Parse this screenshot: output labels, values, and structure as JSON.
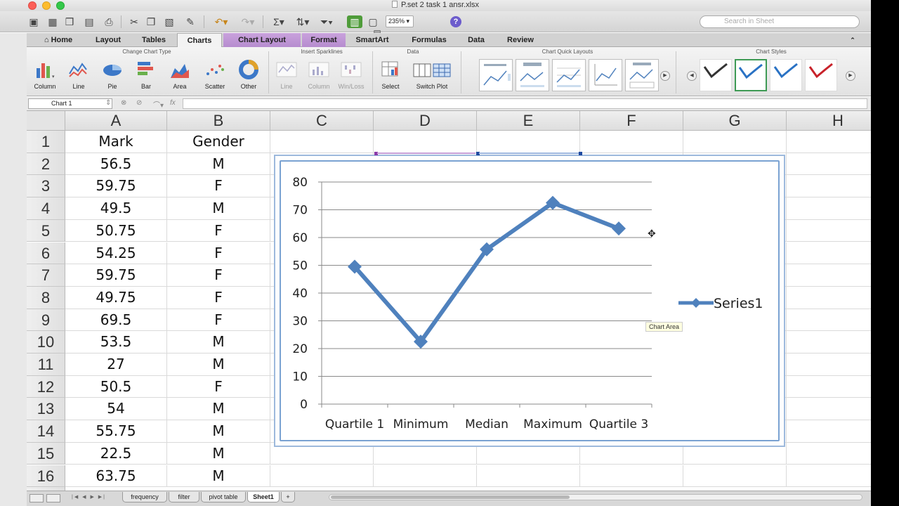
{
  "window": {
    "title": "P.set 2 task 1 ansr.xlsx"
  },
  "toolbar": {
    "zoom": "235%",
    "search_placeholder": "Search in Sheet"
  },
  "tabs": [
    "Home",
    "Layout",
    "Tables",
    "Charts",
    "Chart Layout",
    "Format",
    "SmartArt",
    "Formulas",
    "Data",
    "Review"
  ],
  "ribbon": {
    "groups": {
      "change_chart_type": "Change Chart Type",
      "insert_sparklines": "Insert Sparklines",
      "data": "Data",
      "chart_quick_layouts": "Chart Quick Layouts",
      "chart_styles": "Chart Styles"
    },
    "chart_types": [
      "Column",
      "Line",
      "Pie",
      "Bar",
      "Area",
      "Scatter",
      "Other"
    ],
    "sparklines": [
      "Line",
      "Column",
      "Win/Loss"
    ],
    "data_buttons": [
      "Select",
      "Switch Plot"
    ],
    "style_colors": [
      "#333333",
      "#2a72c4",
      "#2a72c4",
      "#c8222a"
    ]
  },
  "formula_bar": {
    "name_box": "Chart 1",
    "fx": "fx"
  },
  "sheet": {
    "columns": [
      "A",
      "B",
      "C",
      "D",
      "E",
      "F",
      "G",
      "H"
    ],
    "rows": [
      "1",
      "2",
      "3",
      "4",
      "5",
      "6",
      "7",
      "8",
      "9",
      "10",
      "11",
      "12",
      "13",
      "14",
      "15",
      "16"
    ],
    "headers": [
      "Mark",
      "Gender"
    ],
    "marks": [
      "56.5",
      "59.75",
      "49.5",
      "50.75",
      "54.25",
      "59.75",
      "49.75",
      "69.5",
      "53.5",
      "27",
      "50.5",
      "54",
      "55.75",
      "22.5",
      "63.75"
    ],
    "genders": [
      "M",
      "F",
      "M",
      "F",
      "F",
      "F",
      "F",
      "F",
      "M",
      "M",
      "F",
      "M",
      "M",
      "M",
      "M"
    ]
  },
  "tooltip": "Chart Area",
  "sheet_tabs": [
    "frequency",
    "filter",
    "pivot table",
    "Sheet1"
  ],
  "add_sheet": "+",
  "chart_data": {
    "type": "line",
    "categories": [
      "Quartile 1",
      "Minimum",
      "Median",
      "Maximum",
      "Quartile 3"
    ],
    "series": [
      {
        "name": "Series1",
        "values": [
          49.5,
          22.5,
          55.75,
          72.5,
          63.25
        ],
        "color": "#4f81bd"
      }
    ],
    "ylim": [
      0,
      80
    ],
    "yticks": [
      "0",
      "10",
      "20",
      "30",
      "40",
      "50",
      "60",
      "70",
      "80"
    ],
    "grid": true,
    "legend": "right"
  }
}
